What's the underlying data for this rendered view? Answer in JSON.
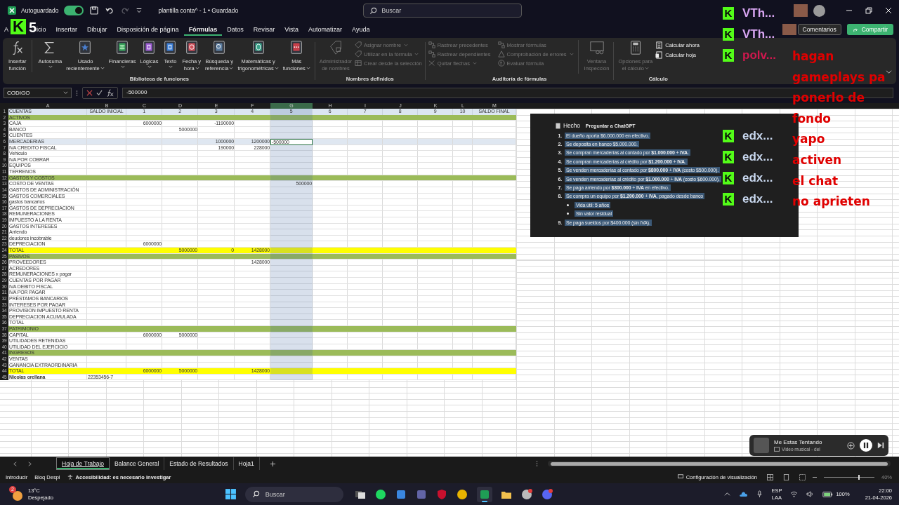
{
  "title_bar": {
    "autosave_label": "Autoguardado",
    "autosave_on": true,
    "document_title": "plantilla conta^ - 1 • Guardado",
    "search_placeholder": "Buscar",
    "redo_disabled": true
  },
  "logo_overlay": {
    "letter": "K",
    "number": "5"
  },
  "ribbon_tabs": [
    {
      "label": "A",
      "selected": false
    },
    {
      "label": "icio",
      "selected": false
    },
    {
      "label": "Insertar",
      "selected": false
    },
    {
      "label": "Dibujar",
      "selected": false
    },
    {
      "label": "Disposición de página",
      "selected": false
    },
    {
      "label": "Fórmulas",
      "selected": true
    },
    {
      "label": "Datos",
      "selected": false
    },
    {
      "label": "Revisar",
      "selected": false
    },
    {
      "label": "Vista",
      "selected": false
    },
    {
      "label": "Automatizar",
      "selected": false
    },
    {
      "label": "Ayuda",
      "selected": false
    }
  ],
  "header_buttons": {
    "comments": "Comentarios",
    "share": "Compartir"
  },
  "ribbon": {
    "function_library": {
      "title": "Biblioteca de funciones",
      "items": [
        {
          "kind": "fx",
          "lines": [
            "Insertar",
            "función"
          ],
          "has_menu": false
        },
        {
          "kind": "sigma",
          "lines": [
            "Autosuma"
          ],
          "has_menu": true
        },
        {
          "kind": "star",
          "lines": [
            "Usado",
            "recientemente"
          ],
          "has_menu": true
        },
        {
          "kind": "coins",
          "lines": [
            "Financieras"
          ],
          "has_menu": true
        },
        {
          "kind": "question",
          "lines": [
            "Lógicas"
          ],
          "has_menu": true
        },
        {
          "kind": "text",
          "lines": [
            "Texto"
          ],
          "has_menu": true
        },
        {
          "kind": "clock",
          "lines": [
            "Fecha y",
            "hora"
          ],
          "has_menu": true
        },
        {
          "kind": "lens",
          "lines": [
            "Búsqueda y",
            "referencia"
          ],
          "has_menu": true
        },
        {
          "kind": "theta",
          "lines": [
            "Matemáticas y",
            "trigonométricas"
          ],
          "has_menu": true
        },
        {
          "kind": "dots",
          "lines": [
            "Más",
            "funciones"
          ],
          "has_menu": true
        }
      ]
    },
    "defined_names": {
      "title": "Nombres definidos",
      "manager": {
        "lines": [
          "Administrador",
          "de nombres"
        ],
        "disabled": true
      },
      "items": [
        {
          "kind": "tag",
          "label": "Asignar nombre",
          "has_menu": true,
          "disabled": true
        },
        {
          "kind": "tag",
          "label": "Utilizar en la fórmula",
          "has_menu": true,
          "disabled": true
        },
        {
          "kind": "grid",
          "label": "Crear desde la selección",
          "has_menu": false,
          "disabled": true
        }
      ]
    },
    "auditing": {
      "title": "Auditoría de fórmulas",
      "items": [
        {
          "kind": "trace",
          "label": "Rastrear precedentes",
          "has_menu": false,
          "disabled": true
        },
        {
          "kind": "trace",
          "label": "Rastrear dependientes",
          "has_menu": false,
          "disabled": true
        },
        {
          "kind": "arrows",
          "label": "Quitar flechas",
          "has_menu": true,
          "disabled": true
        },
        {
          "kind": "formula",
          "label": "Mostrar fórmulas",
          "has_menu": false,
          "disabled": true
        },
        {
          "kind": "warning",
          "label": "Comprobación de errores",
          "has_menu": true,
          "disabled": true
        },
        {
          "kind": "fxcircle",
          "label": "Evaluar fórmula",
          "has_menu": false,
          "disabled": true
        }
      ],
      "watch": {
        "lines": [
          "Ventana",
          "Inspección"
        ],
        "disabled": true
      }
    },
    "calculation": {
      "title": "Cálculo",
      "options": {
        "lines": [
          "Opciones para",
          "el cálculo"
        ],
        "disabled": true
      },
      "items": [
        {
          "kind": "calc",
          "label": "Calcular ahora",
          "has_menu": false,
          "disabled": false
        },
        {
          "kind": "calcsheet",
          "label": "Calcular hoja",
          "has_menu": false,
          "disabled": false
        }
      ]
    }
  },
  "formula_bar": {
    "name_box": "CODIGO",
    "formula": "-500000"
  },
  "sheet": {
    "columns": [
      {
        "letter": "A",
        "selected": false
      },
      {
        "letter": "B",
        "selected": false
      },
      {
        "letter": "C",
        "selected": false
      },
      {
        "letter": "D",
        "selected": false
      },
      {
        "letter": "E",
        "selected": false
      },
      {
        "letter": "F",
        "selected": false
      },
      {
        "letter": "G",
        "selected": true
      },
      {
        "letter": "H",
        "selected": false
      },
      {
        "letter": "I",
        "selected": false
      },
      {
        "letter": "J",
        "selected": false
      },
      {
        "letter": "K",
        "selected": false
      },
      {
        "letter": "L",
        "selected": false
      },
      {
        "letter": "M",
        "selected": false
      }
    ],
    "rows": [
      {
        "number": "1",
        "kind": "header",
        "selected": false,
        "cells": [
          "CUENTAS",
          "SALDO INICIAL",
          "1",
          "2",
          "3",
          "4",
          "5",
          "6",
          "7",
          "8",
          "9",
          "10",
          "SALDO FINAL"
        ]
      },
      {
        "number": "2",
        "kind": "section",
        "selected": false,
        "cells": [
          "ACTIVOS"
        ]
      },
      {
        "number": "3",
        "kind": "plain",
        "selected": false,
        "cells": [
          "CAJA",
          null,
          "6000000",
          null,
          "-1190000"
        ]
      },
      {
        "number": "4",
        "kind": "plain",
        "selected": false,
        "cells": [
          "BANCO",
          null,
          null,
          "5000000"
        ]
      },
      {
        "number": "5",
        "kind": "plain",
        "selected": false,
        "cells": [
          "CLIENTES"
        ]
      },
      {
        "number": "6",
        "kind": "plain",
        "selected": true,
        "cells": [
          "MERCADERIAS",
          null,
          null,
          null,
          "1000000",
          "1200000",
          "-500000"
        ]
      },
      {
        "number": "7",
        "kind": "plain",
        "selected": false,
        "cells": [
          "IVA CREDITO FISCAL",
          null,
          null,
          null,
          "190000",
          "228000"
        ]
      },
      {
        "number": "8",
        "kind": "plain",
        "selected": false,
        "cells": [
          "Vehiculo"
        ]
      },
      {
        "number": "9",
        "kind": "plain",
        "selected": false,
        "cells": [
          "IVA POR COBRAR"
        ]
      },
      {
        "number": "10",
        "kind": "plain",
        "selected": false,
        "cells": [
          "EQUIPOS"
        ]
      },
      {
        "number": "11",
        "kind": "plain",
        "selected": false,
        "cells": [
          "TERRENOS"
        ]
      },
      {
        "number": "12",
        "kind": "section",
        "selected": false,
        "cells": [
          "GASTOS Y COSTOS"
        ]
      },
      {
        "number": "13",
        "kind": "plain",
        "selected": false,
        "cells": [
          "COSTO DE VENTAS",
          null,
          null,
          null,
          null,
          null,
          "500000"
        ]
      },
      {
        "number": "14",
        "kind": "plain",
        "selected": false,
        "cells": [
          "GASTOS DE ADMINISTRACIÓN"
        ]
      },
      {
        "number": "15",
        "kind": "plain",
        "selected": false,
        "cells": [
          "GASTOS COMERCIALES"
        ]
      },
      {
        "number": "16",
        "kind": "plain",
        "selected": false,
        "cells": [
          "gastos bancarios"
        ]
      },
      {
        "number": "17",
        "kind": "plain",
        "selected": false,
        "cells": [
          "GASTOS DE DEPRECIACION"
        ]
      },
      {
        "number": "18",
        "kind": "plain",
        "selected": false,
        "cells": [
          "REMUNERACIONES"
        ]
      },
      {
        "number": "19",
        "kind": "plain",
        "selected": false,
        "cells": [
          "IMPUESTO A LA RENTA"
        ]
      },
      {
        "number": "20",
        "kind": "plain",
        "selected": false,
        "cells": [
          "GASTOS INTERESES"
        ]
      },
      {
        "number": "21",
        "kind": "plain",
        "selected": false,
        "cells": [
          "Arriendo"
        ]
      },
      {
        "number": "22",
        "kind": "plain",
        "selected": false,
        "cells": [
          "deudores incobrable"
        ]
      },
      {
        "number": "23",
        "kind": "plain",
        "selected": false,
        "cells": [
          "DEPRECIACION",
          null,
          "6000000"
        ]
      },
      {
        "number": "24",
        "kind": "total",
        "selected": false,
        "cells": [
          "TOTAL",
          null,
          null,
          "5000000",
          "0",
          "1428000"
        ]
      },
      {
        "number": "25",
        "kind": "section",
        "selected": false,
        "cells": [
          "PASIVOS"
        ]
      },
      {
        "number": "26",
        "kind": "plain",
        "selected": false,
        "cells": [
          "PROVEEDORES",
          null,
          null,
          null,
          null,
          "1428000"
        ]
      },
      {
        "number": "27",
        "kind": "plain",
        "selected": false,
        "cells": [
          "ACREDORES"
        ]
      },
      {
        "number": "28",
        "kind": "plain",
        "selected": false,
        "cells": [
          "REMUNERACIONES x pagar"
        ]
      },
      {
        "number": "29",
        "kind": "plain",
        "selected": false,
        "cells": [
          "CUENTAS POR PAGAR"
        ]
      },
      {
        "number": "30",
        "kind": "plain",
        "selected": false,
        "cells": [
          "IVA DEBITO FISCAL"
        ]
      },
      {
        "number": "31",
        "kind": "plain",
        "selected": false,
        "cells": [
          "IVA POR PAGAR"
        ]
      },
      {
        "number": "32",
        "kind": "plain",
        "selected": false,
        "cells": [
          "PRÉSTAMOS BANCARIOS"
        ]
      },
      {
        "number": "33",
        "kind": "plain",
        "selected": false,
        "cells": [
          "INTERESES POR PAGAR"
        ]
      },
      {
        "number": "34",
        "kind": "plain",
        "selected": false,
        "cells": [
          "PROVISION IMPUESTO RENTA"
        ]
      },
      {
        "number": "35",
        "kind": "plain",
        "selected": false,
        "cells": [
          "DEPRECIACION ACUMULADA"
        ]
      },
      {
        "number": "36",
        "kind": "plain",
        "selected": false,
        "cells": [
          "TOTAL"
        ]
      },
      {
        "number": "37",
        "kind": "section",
        "selected": false,
        "cells": [
          "PATRIMONIO"
        ]
      },
      {
        "number": "38",
        "kind": "plain",
        "selected": false,
        "cells": [
          "CAPITAL",
          null,
          "6000000",
          "5000000"
        ]
      },
      {
        "number": "39",
        "kind": "plain",
        "selected": false,
        "cells": [
          "UTILIDADES RETENIDAS"
        ]
      },
      {
        "number": "40",
        "kind": "plain",
        "selected": false,
        "cells": [
          "UTILIDAD DEL EJERCICIO"
        ]
      },
      {
        "number": "41",
        "kind": "section",
        "selected": false,
        "cells": [
          "INGRESOS"
        ]
      },
      {
        "number": "42",
        "kind": "plain",
        "selected": false,
        "cells": [
          "VENTAS"
        ]
      },
      {
        "number": "43",
        "kind": "plain",
        "selected": false,
        "cells": [
          "GANANCIA EXTRAORDINARIA"
        ]
      },
      {
        "number": "44",
        "kind": "total",
        "selected": false,
        "cells": [
          "TOTAL",
          null,
          "6000000",
          "5000000",
          null,
          "1428000"
        ]
      },
      {
        "number": "45",
        "kind": "signature",
        "selected": false,
        "cells": [
          "Nicolas orellana",
          "22353456-7"
        ]
      }
    ]
  },
  "chatgpt_panel": {
    "title": "Hecho",
    "ask_button": "Preguntar a ChatGPT",
    "items": [
      {
        "number": "1.",
        "text": "El dueño aporta $6.000.000 en efectivo."
      },
      {
        "number": "2.",
        "text": "Se deposita en banco $5.000.000."
      },
      {
        "number": "3.",
        "text": "Se compran mercaderías al contado por **$1.000.000** + **IVA**."
      },
      {
        "number": "4.",
        "text": "Se compran mercaderías al crédito por **$1.200.000** + **IVA**."
      },
      {
        "number": "5.",
        "text": "Se venden mercaderías al contado por **$800.000** + **IVA** (costo $500.000)."
      },
      {
        "number": "6.",
        "text": "Se venden mercaderías al crédito por **$1.000.000** + **IVA** (costo $600.000)."
      },
      {
        "number": "7.",
        "text": "Se paga arriendo por **$300.000** + **IVA** en efectivo."
      },
      {
        "number": "8.",
        "text": "Se compra un equipo por **$1.200.000** + **IVA**, pagado desde banco",
        "sub": [
          "Vida útil: 5 años",
          "Sin valor residual"
        ]
      },
      {
        "number": "9.",
        "text": "Se paga sueldos por $400.000 (sin IVA)."
      }
    ]
  },
  "stream_overlay": {
    "users_top": [
      {
        "badge": "K",
        "name": "VTh...",
        "color": "#d9a6f2"
      },
      {
        "badge": "K",
        "name": "VTh...",
        "color": "#d9a6f2"
      },
      {
        "badge": "K",
        "name": "polv...",
        "color": "#d0184e"
      }
    ],
    "users_bottom": [
      {
        "badge": "K",
        "name": "edx...",
        "color": "#c9d8ef"
      },
      {
        "badge": "K",
        "name": "edx...",
        "color": "#c9d8ef"
      },
      {
        "badge": "K",
        "name": "edx...",
        "color": "#c9d8ef"
      },
      {
        "badge": "K",
        "name": "edx...",
        "color": "#c9d8ef"
      }
    ],
    "messages": [
      "hagan",
      "gameplays pa",
      "ponerlo de",
      "fondo",
      "yapo",
      "activen",
      "el chat",
      "no aprieten"
    ]
  },
  "media_player": {
    "title": "Me Estas Tentando",
    "subtitle": "Video musical - del",
    "playing": true
  },
  "sheet_tabs": [
    {
      "label": "Hoja de Trabajo",
      "selected": true
    },
    {
      "label": "Balance General",
      "selected": false
    },
    {
      "label": "Estado de Resultados",
      "selected": false
    },
    {
      "label": "Hoja1",
      "selected": false
    }
  ],
  "status_bar": {
    "mode": "Introducir",
    "scroll_lock": "Bloq Despl",
    "accessibility": "Accesibilidad: es necesario investigar",
    "display_settings": "Configuración de visualización",
    "zoom": "40%",
    "level": 0.68
  },
  "taskbar": {
    "weather": {
      "badge": "2",
      "temperature": "13°C",
      "condition": "Despejado"
    },
    "search_placeholder": "Buscar",
    "apps": [
      {
        "kind": "taskview",
        "active": false,
        "badge": false
      },
      {
        "kind": "spotify",
        "active": false,
        "badge": false
      },
      {
        "kind": "store",
        "active": false,
        "badge": false
      },
      {
        "kind": "teams",
        "active": false,
        "badge": false
      },
      {
        "kind": "shield",
        "active": false,
        "badge": false
      },
      {
        "kind": "chrome",
        "active": false,
        "badge": false
      },
      {
        "kind": "excel",
        "active": true,
        "badge": false
      },
      {
        "kind": "folder",
        "active": false,
        "badge": false
      },
      {
        "kind": "gearapp",
        "active": false,
        "badge": true
      },
      {
        "kind": "discord",
        "active": false,
        "badge": true
      }
    ],
    "language": "ESP",
    "layout": "LAA",
    "battery": "100%",
    "time": "22:00",
    "date": "21-04-2026"
  }
}
